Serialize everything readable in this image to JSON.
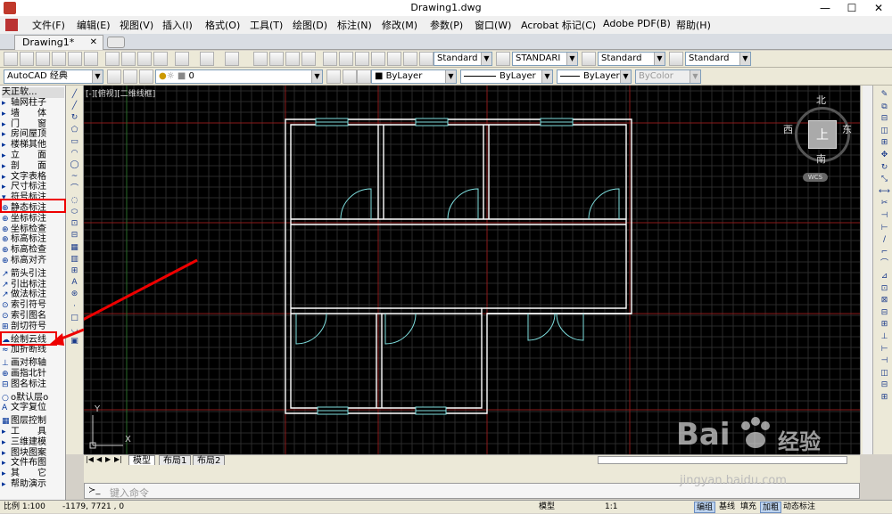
{
  "window": {
    "title": "Drawing1.dwg",
    "minimize": "—",
    "maximize": "☐",
    "close": "✕"
  },
  "menu": [
    "文件(F)",
    "编辑(E)",
    "视图(V)",
    "插入(I)",
    "格式(O)",
    "工具(T)",
    "绘图(D)",
    "标注(N)",
    "修改(M)",
    "参数(P)",
    "窗口(W)",
    "Acrobat 标记(C)",
    "Adobe PDF(B)",
    "帮助(H)"
  ],
  "doc_tab": {
    "label": "Drawing1*",
    "close": "✕"
  },
  "toolbar1": {
    "text_style": "Standard",
    "dim_style": "STANDARI",
    "table_style": "Standard",
    "multileader_style": "Standard"
  },
  "toolbar2": {
    "workspace": "AutoCAD 经典",
    "layer": "0",
    "color": "ByLayer",
    "linetype": "ByLayer",
    "lineweight": "ByLayer",
    "plotstyle": "ByColor"
  },
  "left_panel": {
    "header": "天正软...",
    "items": [
      "轴网柱子",
      "墙　　体",
      "门　　窗",
      "房间屋顶",
      "楼梯其他",
      "立　　面",
      "剖　　面",
      "文字表格",
      "尺寸标注",
      "符号标注",
      "静态标注",
      "坐标标注",
      "坐标检查",
      "标高标注",
      "标高检查",
      "标高对齐",
      "箭头引注",
      "引出标注",
      "做法标注",
      "索引符号",
      "索引图名",
      "剖切符号",
      "绘制云线",
      "加折断线",
      "画对称轴",
      "画指北针",
      "图名标注",
      "o默认层o",
      "文字复位",
      "图层控制",
      "工　　具",
      "三维建模",
      "图块图案",
      "文件布图",
      "其　　它",
      "帮助演示"
    ]
  },
  "canvas": {
    "viewport_label": "[-][俯视][二维线框]",
    "compass": {
      "north": "北",
      "south": "南",
      "east": "东",
      "west": "西",
      "top": "上",
      "wcs": "WCS"
    },
    "ucs": {
      "x": "X",
      "y": "Y"
    }
  },
  "layout_tabs": [
    "模型",
    "布局1",
    "布局2"
  ],
  "command": {
    "placeholder": "键入命令"
  },
  "status": {
    "scale": "比例 1:100",
    "coords": "-1179, 7721 , 0",
    "model": "模型",
    "viewscale": "1:1",
    "toggles": [
      "编组",
      "基线",
      "填充",
      "加粗",
      "动态标注"
    ]
  },
  "watermark": {
    "brand": "Bai",
    "brand2": "经验",
    "url": "jingyan.baidu.com"
  },
  "colors": {
    "canvas": "#000000",
    "wall": "#ffffff",
    "door": "#7fe0e0",
    "axis": "#8b1a1a",
    "highlight": "#e00000"
  }
}
